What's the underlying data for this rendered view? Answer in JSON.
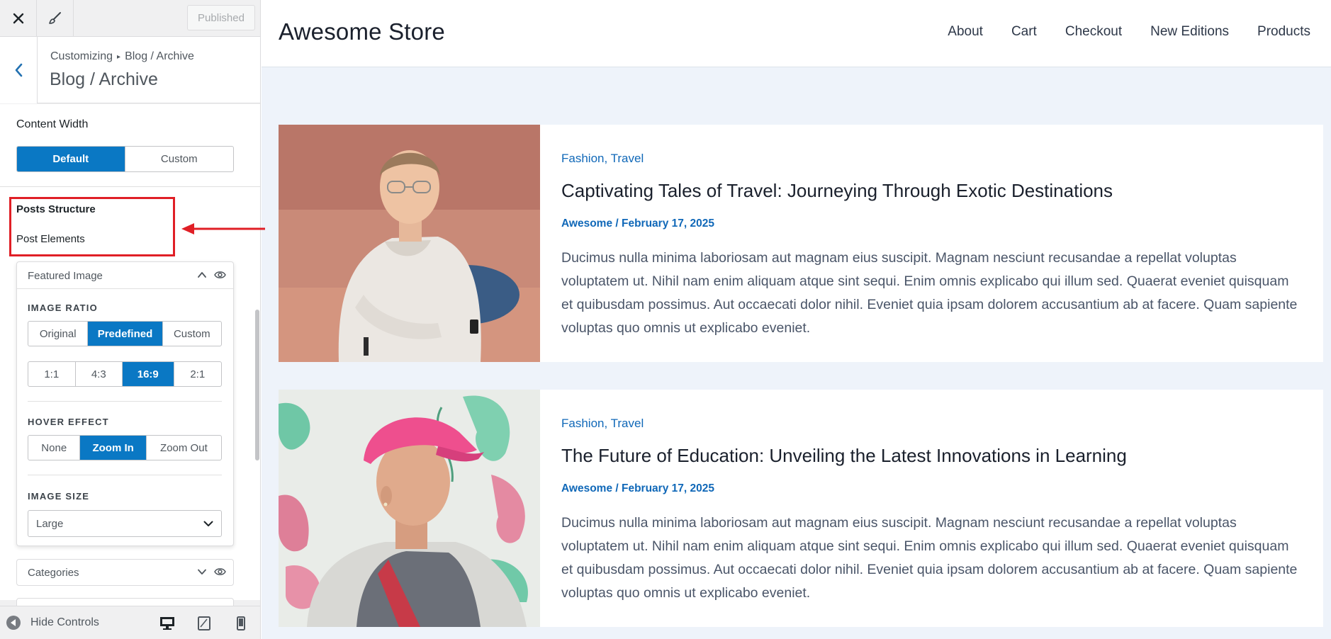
{
  "customizer": {
    "topbar": {
      "published_label": "Published"
    },
    "header": {
      "breadcrumb_root": "Customizing",
      "breadcrumb_current": "Blog / Archive",
      "title": "Blog / Archive"
    },
    "content_width": {
      "label": "Content Width",
      "options": [
        "Default",
        "Custom"
      ],
      "selected": "Default"
    },
    "posts_structure_label": "Posts Structure",
    "post_elements_label": "Post Elements",
    "featured_image": {
      "title": "Featured Image",
      "image_ratio_label": "IMAGE RATIO",
      "ratio_options": [
        "Original",
        "Predefined",
        "Custom"
      ],
      "ratio_selected": "Predefined",
      "aspect_options": [
        "1:1",
        "4:3",
        "16:9",
        "2:1"
      ],
      "aspect_selected": "16:9",
      "hover_effect_label": "HOVER EFFECT",
      "hover_options": [
        "None",
        "Zoom In",
        "Zoom Out"
      ],
      "hover_selected": "Zoom In",
      "image_size_label": "IMAGE SIZE",
      "image_size_value": "Large"
    },
    "categories_title": "Categories",
    "footer": {
      "hide_controls_label": "Hide Controls"
    }
  },
  "site": {
    "title": "Awesome Store",
    "nav": [
      "About",
      "Cart",
      "Checkout",
      "New Editions",
      "Products"
    ]
  },
  "posts": [
    {
      "categories": "Fashion, Travel",
      "title": "Captivating Tales of Travel: Journeying Through Exotic Destinations",
      "meta": "Awesome / February 17, 2025",
      "excerpt": "Ducimus nulla minima laboriosam aut magnam eius suscipit. Magnam nesciunt recusandae a repellat voluptas voluptatem ut. Nihil nam enim aliquam atque sint sequi. Enim omnis explicabo qui illum sed. Quaerat eveniet quisquam et quibusdam possimus. Aut occaecati dolor nihil. Eveniet quia ipsam dolorem accusantium ab at facere. Quam sapiente voluptas quo omnis ut explicabo eveniet."
    },
    {
      "categories": "Fashion, Travel",
      "title": "The Future of Education: Unveiling the Latest Innovations in Learning",
      "meta": "Awesome / February 17, 2025",
      "excerpt": "Ducimus nulla minima laboriosam aut magnam eius suscipit. Magnam nesciunt recusandae a repellat voluptas voluptatem ut. Nihil nam enim aliquam atque sint sequi. Enim omnis explicabo qui illum sed. Quaerat eveniet quisquam et quibusdam possimus. Aut occaecati dolor nihil. Eveniet quia ipsam dolorem accusantium ab at facere. Quam sapiente voluptas quo omnis ut explicabo eveniet."
    }
  ],
  "colors": {
    "accent": "#0a78c4",
    "link": "#1068b8",
    "highlight": "#e01f26",
    "preview_bg": "#eef3fa"
  }
}
